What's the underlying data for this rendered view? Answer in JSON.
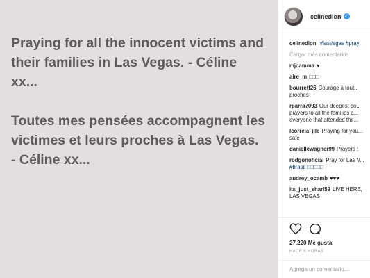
{
  "post": {
    "line1": "Praying for all the innocent victims and their families in Las Vegas. - Céline xx...",
    "line2": "Toutes mes pensées accompagnent les victimes et leurs proches à Las Vegas. - Céline xx..."
  },
  "header": {
    "username": "celinedion",
    "verified_mark": "✓"
  },
  "caption": {
    "user": "celinedion",
    "tags": "#lasvegas #pray"
  },
  "load_more": "Cargar más comentarios",
  "comments": [
    {
      "user": "mjcamma",
      "text": "♥"
    },
    {
      "user": "aire_m",
      "text": "□□□"
    },
    {
      "user": "bourretf26",
      "text": "Courage à tout... proches"
    },
    {
      "user": "rparra7093",
      "text": "Our deepest co... prayers to all the families a... everyone that attended the..."
    },
    {
      "user": "lcorreia_jlle",
      "text": "Praying for you... safe"
    },
    {
      "user": "daniellewagner99",
      "text": "Prayers !"
    },
    {
      "user": "rodgonoficial",
      "text": "Pray for Las V...",
      "tag": "#brasil □□□□□"
    },
    {
      "user": "audrey_ocamb",
      "text": "♥♥♥"
    },
    {
      "user": "its_just_shari59",
      "text": "LIVE HERE, LAS VEGAS"
    }
  ],
  "likes": "27.220 Me gusta",
  "time": "HACE 8 HORAS",
  "add_comment_placeholder": "Agrega un comentario..."
}
